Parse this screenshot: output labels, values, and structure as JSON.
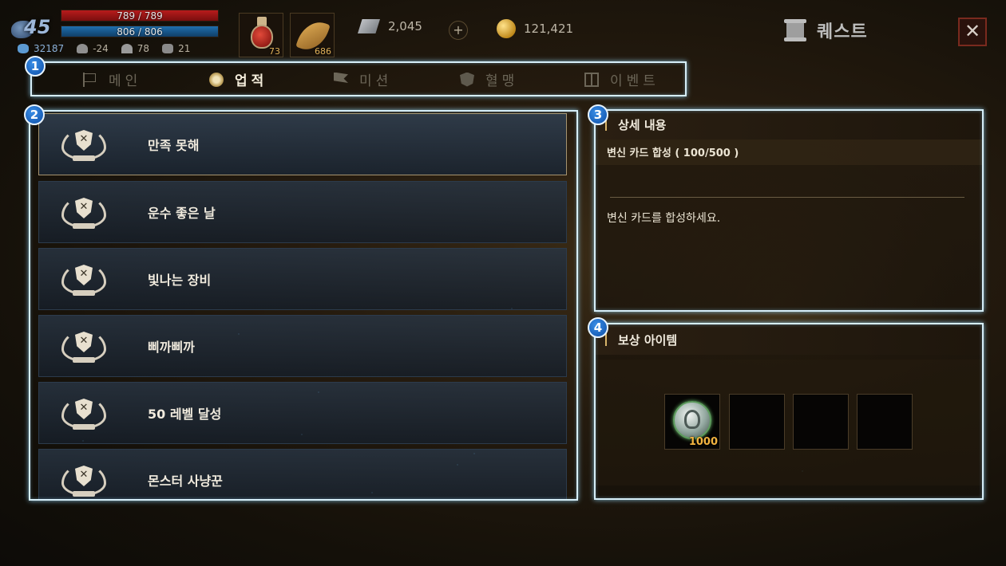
{
  "player": {
    "level": "45",
    "hp": "789 / 789",
    "mp": "806 / 806",
    "stats": [
      "32187",
      "-24",
      "78",
      "21"
    ]
  },
  "quick_slots": [
    {
      "icon": "potion-icon",
      "count": "73"
    },
    {
      "icon": "leaf-icon",
      "count": "686"
    }
  ],
  "currency": {
    "crystal": "2,045",
    "gold": "121,421",
    "plus_label": "+"
  },
  "header": {
    "title": "퀘스트",
    "close_label": "✕"
  },
  "markers": [
    "1",
    "2",
    "3",
    "4"
  ],
  "tabs": [
    {
      "label": "메인",
      "icon": "flag-icon",
      "active": false
    },
    {
      "label": "업적",
      "icon": "medal-icon",
      "active": true
    },
    {
      "label": "미션",
      "icon": "mission-flag-icon",
      "active": false
    },
    {
      "label": "혈맹",
      "icon": "guild-shield-icon",
      "active": false
    },
    {
      "label": "이벤트",
      "icon": "gift-icon",
      "active": false
    }
  ],
  "achievements": [
    {
      "label": "만족 못해",
      "selected": true
    },
    {
      "label": "운수 좋은 날",
      "selected": false
    },
    {
      "label": "빛나는 장비",
      "selected": false
    },
    {
      "label": "삐까삐까",
      "selected": false
    },
    {
      "label": "50 레벨 달성",
      "selected": false
    },
    {
      "label": "몬스터 사냥꾼",
      "selected": false
    }
  ],
  "detail": {
    "title": "상세 내용",
    "task": "변신 카드 합성 ( 100/500 )",
    "description": "변신 카드를 합성하세요."
  },
  "reward": {
    "title": "보상 아이템",
    "items": [
      {
        "icon": "silver-coin-icon",
        "count": "1000"
      },
      {
        "icon": "",
        "count": ""
      },
      {
        "icon": "",
        "count": ""
      },
      {
        "icon": "",
        "count": ""
      }
    ]
  },
  "colors": {
    "highlight_frame": "#d6eef8",
    "marker": "#1a64c4",
    "hp_bar": "#b81c1c",
    "mp_bar": "#1f6fae",
    "reward_count": "#f2b440"
  }
}
